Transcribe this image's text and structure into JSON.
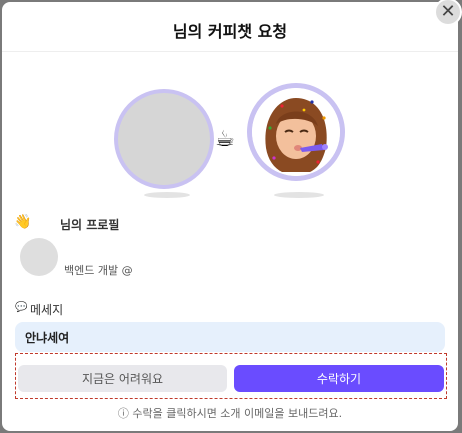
{
  "dialog": {
    "title": "님의 커피챗 요청",
    "close_glyph": "✕"
  },
  "illustration": {
    "coffee_glyph": "☕"
  },
  "profile": {
    "icon_glyph": "👋",
    "heading": "님의 프로필",
    "job": "백엔드 개발 @"
  },
  "message": {
    "icon_glyph": "💬",
    "heading": "메세지",
    "text": "안냐세여"
  },
  "actions": {
    "decline_label": "지금은 어려워요",
    "accept_label": "수락하기"
  },
  "footnote": "ⓘ 수락을 클릭하시면 소개 이메일을 보내드려요.",
  "colors": {
    "accent": "#6a4cff",
    "ring": "#c9c2f2",
    "message_bg": "#e6f0fc"
  }
}
